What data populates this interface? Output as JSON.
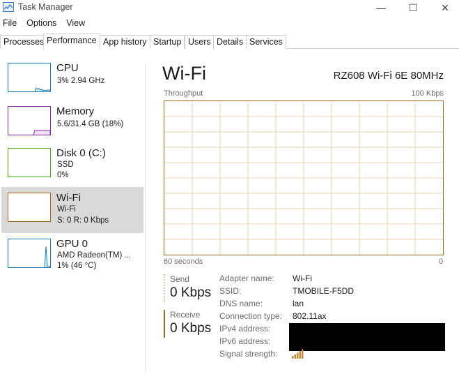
{
  "window": {
    "title": "Task Manager",
    "controls": {
      "minimize": "—",
      "maximize": "☐",
      "close": "✕"
    }
  },
  "menu": [
    "File",
    "Options",
    "View"
  ],
  "tabs": [
    {
      "label": "Processes",
      "active": false
    },
    {
      "label": "Performance",
      "active": true
    },
    {
      "label": "App history",
      "active": false
    },
    {
      "label": "Startup",
      "active": false
    },
    {
      "label": "Users",
      "active": false
    },
    {
      "label": "Details",
      "active": false
    },
    {
      "label": "Services",
      "active": false
    }
  ],
  "sidebar": {
    "items": [
      {
        "name": "CPU",
        "lines": [
          "3% 2.94 GHz"
        ],
        "color": "#1b7fb7",
        "selected": false
      },
      {
        "name": "Memory",
        "lines": [
          "5.6/31.4 GB (18%)"
        ],
        "color": "#8b26a8",
        "selected": false
      },
      {
        "name": "Disk 0 (C:)",
        "lines": [
          "SSD",
          "0%"
        ],
        "color": "#4da60c",
        "selected": false
      },
      {
        "name": "Wi-Fi",
        "lines": [
          "Wi-Fi",
          "S: 0 R: 0 Kbps"
        ],
        "color": "#a5681a",
        "selected": true
      },
      {
        "name": "GPU 0",
        "lines": [
          "AMD Radeon(TM) ...",
          "1% (46 °C)"
        ],
        "color": "#1b7fb7",
        "selected": false
      }
    ]
  },
  "main": {
    "title": "Wi-Fi",
    "adapter_model": "RZ608 Wi-Fi 6E 80MHz",
    "graph": {
      "label": "Throughput",
      "max_label": "100 Kbps",
      "time_label": "60 seconds",
      "zero_label": "0",
      "border_color": "#9a6a1e",
      "grid_color": "#e6d3b3"
    },
    "send": {
      "label": "Send",
      "value": "0 Kbps"
    },
    "receive": {
      "label": "Receive",
      "value": "0 Kbps"
    },
    "info": [
      {
        "label": "Adapter name:",
        "value": "Wi-Fi"
      },
      {
        "label": "SSID:",
        "value": "TMOBILE-F5DD"
      },
      {
        "label": "DNS name:",
        "value": "lan"
      },
      {
        "label": "Connection type:",
        "value": "802.11ax"
      },
      {
        "label": "IPv4 address:",
        "value": ""
      },
      {
        "label": "IPv6 address:",
        "value": ""
      },
      {
        "label": "Signal strength:",
        "value": ""
      }
    ],
    "signal_icon": "signal-strength-icon"
  }
}
